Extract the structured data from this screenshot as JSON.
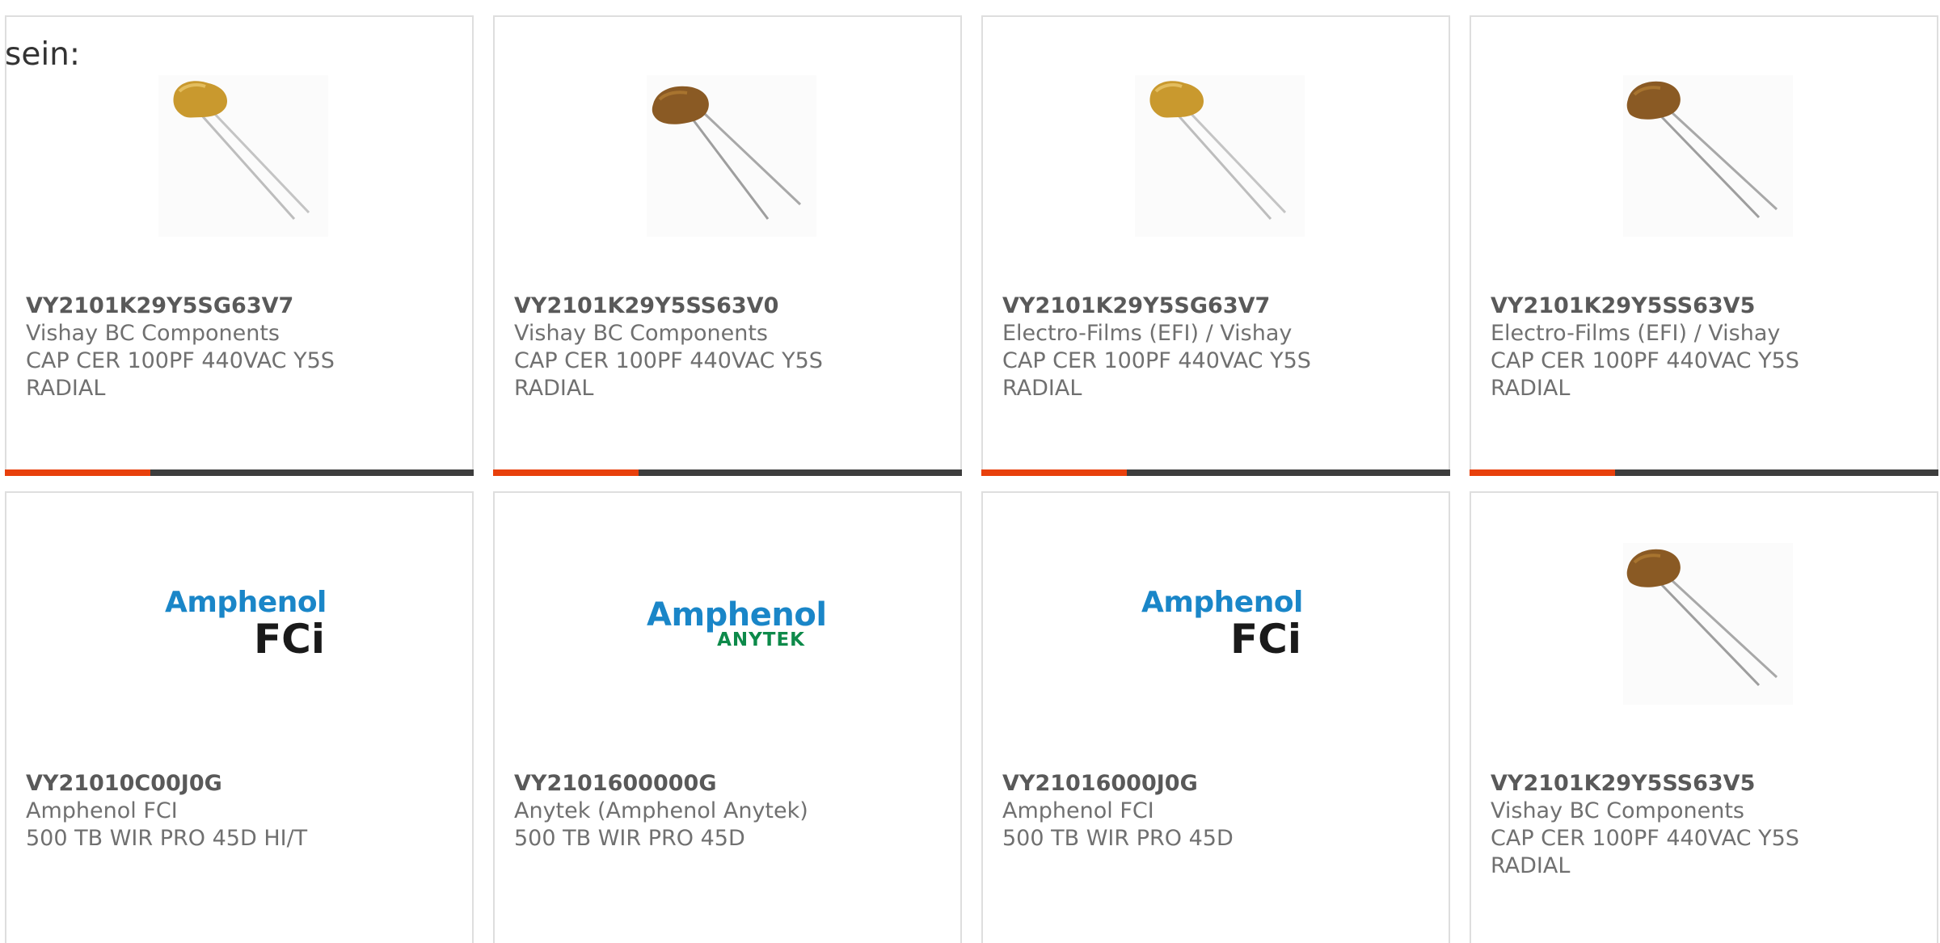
{
  "intro_text": "sein:",
  "products": [
    {
      "part_number": "VY2101K29Y5SG63V7",
      "manufacturer": "Vishay BC Components",
      "desc_line1": "CAP CER 100PF 440VAC Y5S",
      "desc_line2": "RADIAL",
      "image": "ceramic-capacitor-yellow",
      "progress": 0.31
    },
    {
      "part_number": "VY2101K29Y5SS63V0",
      "manufacturer": "Vishay BC Components",
      "desc_line1": "CAP CER 100PF 440VAC Y5S",
      "desc_line2": "RADIAL",
      "image": "ceramic-capacitor-brown",
      "progress": 0.31
    },
    {
      "part_number": "VY2101K29Y5SG63V7",
      "manufacturer": "Electro-Films (EFI) / Vishay",
      "desc_line1": "CAP CER 100PF 440VAC Y5S",
      "desc_line2": "RADIAL",
      "image": "ceramic-capacitor-yellow",
      "progress": 0.31
    },
    {
      "part_number": "VY2101K29Y5SS63V5",
      "manufacturer": "Electro-Films (EFI) / Vishay",
      "desc_line1": "CAP CER 100PF 440VAC Y5S",
      "desc_line2": "RADIAL",
      "image": "ceramic-capacitor-brown",
      "progress": 0.31
    },
    {
      "part_number": "VY21010C00J0G",
      "manufacturer": "Amphenol FCI",
      "desc_line1": "500 TB WIR PRO 45D HI/T",
      "desc_line2": "",
      "image": "amphenol-fci-logo",
      "logo_top": "Amphenol",
      "logo_bottom": "FCi"
    },
    {
      "part_number": "VY2101600000G",
      "manufacturer": "Anytek (Amphenol Anytek)",
      "desc_line1": "500 TB WIR PRO 45D",
      "desc_line2": "",
      "image": "amphenol-anytek-logo",
      "logo_top": "Amphenol",
      "logo_bottom": "ANYTEK"
    },
    {
      "part_number": "VY21016000J0G",
      "manufacturer": "Amphenol FCI",
      "desc_line1": "500 TB WIR PRO 45D",
      "desc_line2": "",
      "image": "amphenol-fci-logo",
      "logo_top": "Amphenol",
      "logo_bottom": "FCi"
    },
    {
      "part_number": "VY2101K29Y5SS63V5",
      "manufacturer": "Vishay BC Components",
      "desc_line1": "CAP CER 100PF 440VAC Y5S",
      "desc_line2": "RADIAL",
      "image": "ceramic-capacitor-brown"
    }
  ],
  "colors": {
    "progress_fill": "#e8400c",
    "progress_track": "#3d3d3d",
    "card_border": "#dedede",
    "capacitor_yellow": "#c9992e",
    "capacitor_brown": "#8a5a24",
    "amphenol_blue": "#1a86c8",
    "anytek_green": "#0d8a4a"
  }
}
